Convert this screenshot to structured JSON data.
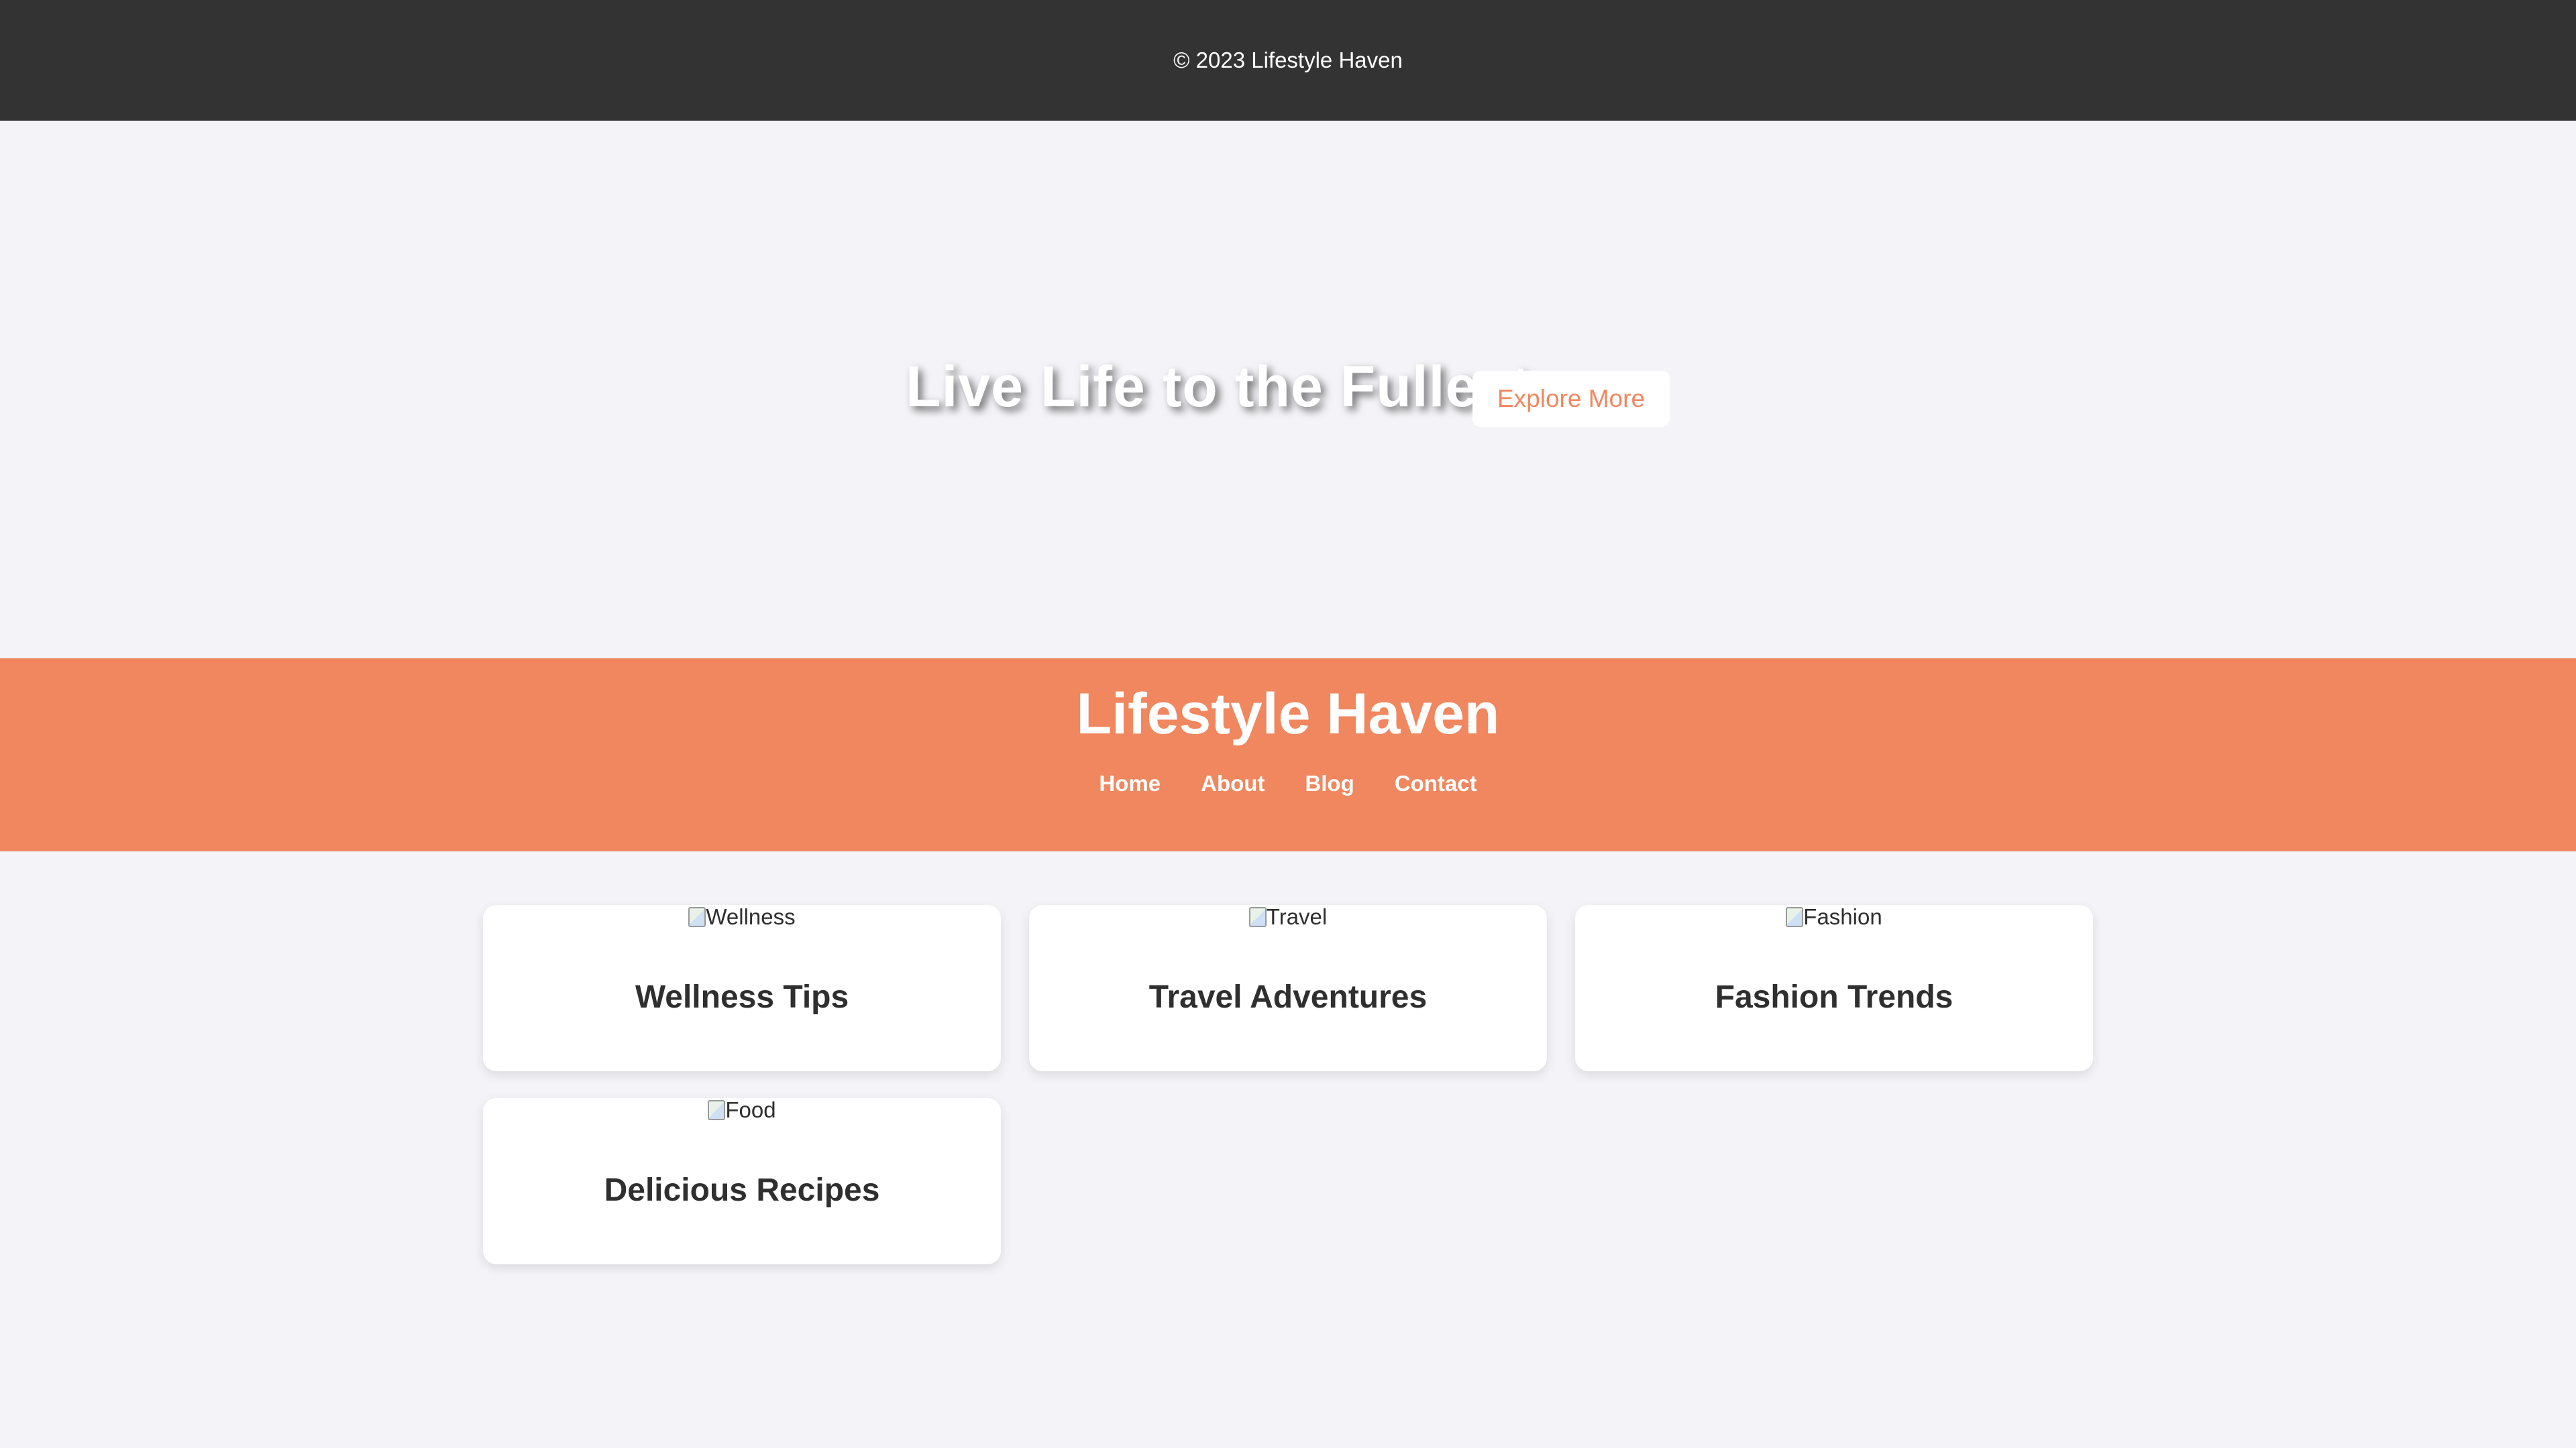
{
  "footer": {
    "copyright": "© 2023 Lifestyle Haven"
  },
  "hero": {
    "title": "Live Life to the Fullest",
    "button_label": "Explore More"
  },
  "header": {
    "site_title": "Lifestyle Haven",
    "nav": [
      {
        "label": "Home"
      },
      {
        "label": "About"
      },
      {
        "label": "Blog"
      },
      {
        "label": "Contact"
      }
    ]
  },
  "cards": [
    {
      "image_alt": "Wellness",
      "title": "Wellness Tips"
    },
    {
      "image_alt": "Travel",
      "title": "Travel Adventures"
    },
    {
      "image_alt": "Fashion",
      "title": "Fashion Trends"
    },
    {
      "image_alt": "Food",
      "title": "Delicious Recipes"
    }
  ],
  "colors": {
    "accent": "#f0875f",
    "footer_bg": "#333333",
    "page_bg": "#f4f4f8"
  }
}
